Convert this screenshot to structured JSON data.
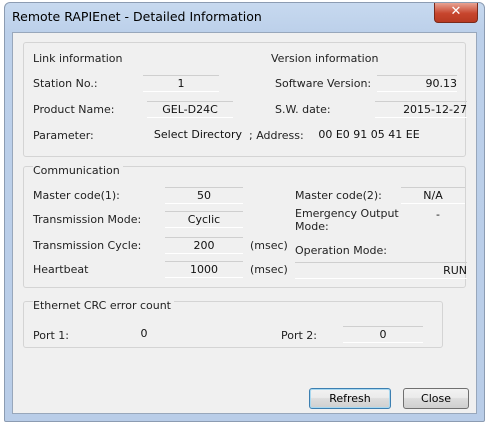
{
  "window": {
    "title": "Remote RAPIEnet - Detailed Information"
  },
  "link": {
    "heading": "Link information",
    "station_label": "Station No.:",
    "station_value": "1",
    "product_label": "Product Name:",
    "product_value": "GEL-D24C",
    "parameter_label": "Parameter:",
    "parameter_value": "Select Directory"
  },
  "version": {
    "heading": "Version information",
    "sw_label": "Software Version:",
    "sw_value": "90.13",
    "date_label": "S.W. date:",
    "date_value": "2015-12-27",
    "address_label": "; Address:",
    "address_value": "00 E0 91 05 41 EE"
  },
  "comm": {
    "heading": "Communication",
    "master1_label": "Master code(1):",
    "master1_value": "50",
    "mode_label": "Transmission Mode:",
    "mode_value": "Cyclic",
    "cycle_label": "Transmission Cycle:",
    "cycle_value": "200",
    "cycle_unit": "(msec)",
    "heartbeat_label": "Heartbeat",
    "heartbeat_value": "1000",
    "heartbeat_unit": "(msec)",
    "master2_label": "Master code(2):",
    "master2_value": "N/A",
    "emergency_label_1": "Emergency Output",
    "emergency_label_2": "Mode:",
    "emergency_value": "-",
    "operation_label": "Operation Mode:",
    "operation_value": "RUN"
  },
  "crc": {
    "heading": "Ethernet CRC error count",
    "port1_label": "Port 1:",
    "port1_value": "0",
    "port2_label": "Port 2:",
    "port2_value": "0"
  },
  "buttons": {
    "refresh": "Refresh",
    "close": "Close"
  },
  "icons": {
    "close": "close-icon"
  }
}
